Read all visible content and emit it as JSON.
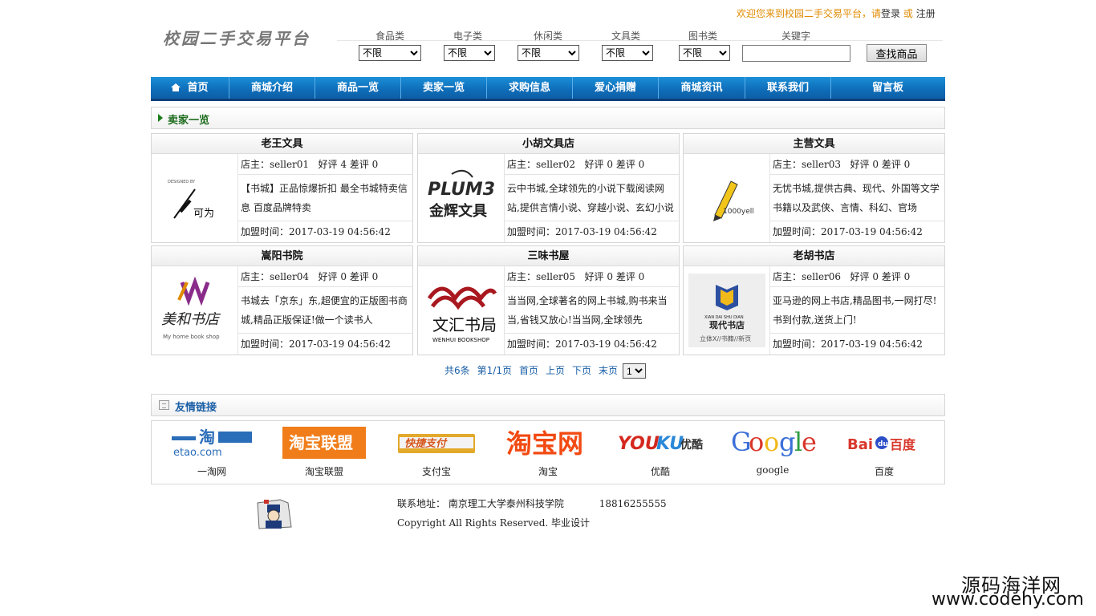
{
  "header": {
    "welcome_text": "欢迎您来到校园二手交易平台，请",
    "login": "登录",
    "or": "或",
    "register": "注册",
    "logo_text": "校园二手交易平台"
  },
  "filters": [
    {
      "label": "食品类",
      "value": "不限"
    },
    {
      "label": "电子类",
      "value": "不限"
    },
    {
      "label": "休闲类",
      "value": "不限"
    },
    {
      "label": "文具类",
      "value": "不限"
    },
    {
      "label": "图书类",
      "value": "不限"
    }
  ],
  "keyword_label": "关键字",
  "keyword_value": "",
  "search_button": "查找商品",
  "nav": [
    "首页",
    "商城介绍",
    "商品一览",
    "卖家一览",
    "求购信息",
    "爱心捐赠",
    "商城资讯",
    "联系我们",
    "留言板"
  ],
  "section_title": "卖家一览",
  "owner_label": "店主：",
  "good_label": "好评",
  "bad_label": "差评",
  "join_label": "加盟时间：",
  "sellers": [
    {
      "name": "老王文具",
      "owner": "seller01",
      "good": "4",
      "bad": "0",
      "desc": "【书城】正品惊爆折扣 最全书城特卖信息 百度品牌特卖",
      "joined": "2017-03-19 04:56:42",
      "logo": "可为"
    },
    {
      "name": "小胡文具店",
      "owner": "seller02",
      "good": "0",
      "bad": "0",
      "desc": "云中书城,全球领先的小说下载阅读网站,提供言情小说、穿越小说、玄幻小说",
      "joined": "2017-03-19 04:56:42",
      "logo": "金辉文具"
    },
    {
      "name": "主营文具",
      "owner": "seller03",
      "good": "0",
      "bad": "0",
      "desc": "无忧书城,提供古典、现代、外国等文学书籍以及武侠、言情、科幻、官场",
      "joined": "2017-03-19 04:56:42",
      "logo": "1000yell"
    },
    {
      "name": "嵩阳书院",
      "owner": "seller04",
      "good": "0",
      "bad": "0",
      "desc": "书城去「京东」东,超便宜的正版图书商城,精品正版保证!做一个读书人",
      "joined": "2017-03-19 04:56:42",
      "logo": "美和书店"
    },
    {
      "name": "三味书屋",
      "owner": "seller05",
      "good": "0",
      "bad": "0",
      "desc": "当当网,全球著名的网上书城,购书来当当,省钱又放心!当当网,全球领先",
      "joined": "2017-03-19 04:56:42",
      "logo": "文汇书局"
    },
    {
      "name": "老胡书店",
      "owner": "seller06",
      "good": "0",
      "bad": "0",
      "desc": "亚马逊的网上书店,精品图书,一网打尽!书到付款,送货上门!",
      "joined": "2017-03-19 04:56:42",
      "logo": "现代书店"
    }
  ],
  "pager": {
    "total": "共6条",
    "page": "第1/1页",
    "first": "首页",
    "prev": "上页",
    "next": "下页",
    "last": "末页",
    "current": "1"
  },
  "links_title": "友情链接",
  "links": [
    {
      "name": "一淘网",
      "logo": "一淘"
    },
    {
      "name": "淘宝联盟",
      "logo": "淘宝联盟"
    },
    {
      "name": "支付宝",
      "logo": "快捷支付"
    },
    {
      "name": "淘宝",
      "logo": "淘宝网"
    },
    {
      "name": "优酷",
      "logo": "YOUKU优酷"
    },
    {
      "name": "google",
      "logo": "Google"
    },
    {
      "name": "百度",
      "logo": "Bai百度"
    }
  ],
  "footer": {
    "address_label": "联系地址：",
    "address": "南京理工大学泰州科技学院",
    "phone": "18816255555",
    "copyright": "Copyright All Rights Reserved. 毕业设计"
  },
  "watermark": {
    "line1": "源码海洋网",
    "line2": "www.codehy.com"
  },
  "colors": {
    "nav_blue": "#0f6cb8",
    "section_green": "#1a6a1a",
    "link_blue": "#1a5fa6",
    "welcome_orange": "#e08a00"
  }
}
